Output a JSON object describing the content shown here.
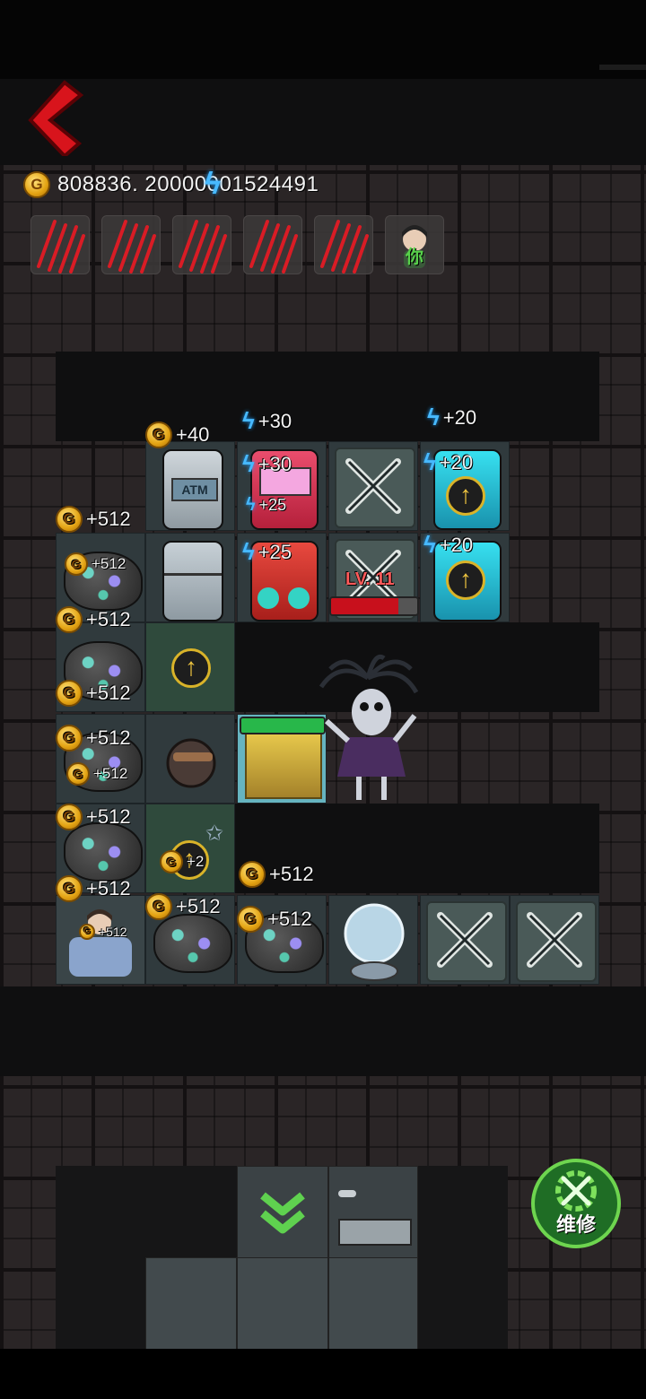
{
  "header": {
    "back_icon": "back-arrow-icon",
    "gold_amount": "808836. 20000001524491",
    "gold_icon_letter": "G"
  },
  "team": [
    {
      "type": "claw-marks"
    },
    {
      "type": "claw-marks"
    },
    {
      "type": "claw-marks"
    },
    {
      "type": "claw-marks"
    },
    {
      "type": "claw-marks"
    },
    {
      "type": "player",
      "label": "你"
    }
  ],
  "grid": {
    "atm": {
      "income": "+40",
      "screen_label": "ATM"
    },
    "arcade1": {
      "power_top": "+30",
      "power_mid": "+30",
      "power_small": "+25"
    },
    "arcade2": {
      "power": "+25"
    },
    "vending1": {
      "power_top": "+20",
      "power_mid": "+20"
    },
    "vending2": {
      "power": "+20"
    },
    "door": {
      "level": "LV. 11",
      "hp_fraction": 0.78
    },
    "gold_door": {
      "hp_fraction": 1.0
    },
    "mines": [
      {
        "income": "+512",
        "small": "+512"
      },
      {
        "income": "+512",
        "small": "+512"
      },
      {
        "income": "+512",
        "small": "+512"
      },
      {
        "income": "+512",
        "small": "+2"
      },
      {
        "income": "+512",
        "small": "+512"
      }
    ],
    "bottom_mines": [
      {
        "income": "+512"
      },
      {
        "income": "+512",
        "extra": "+512"
      }
    ]
  },
  "actions": {
    "repair_label": "维修",
    "down_icon": "double-chevron-down-icon"
  },
  "colors": {
    "accent_green": "#6ed54f",
    "gold": "#e3a313",
    "power": "#47b9ff",
    "danger": "#c8101c"
  }
}
